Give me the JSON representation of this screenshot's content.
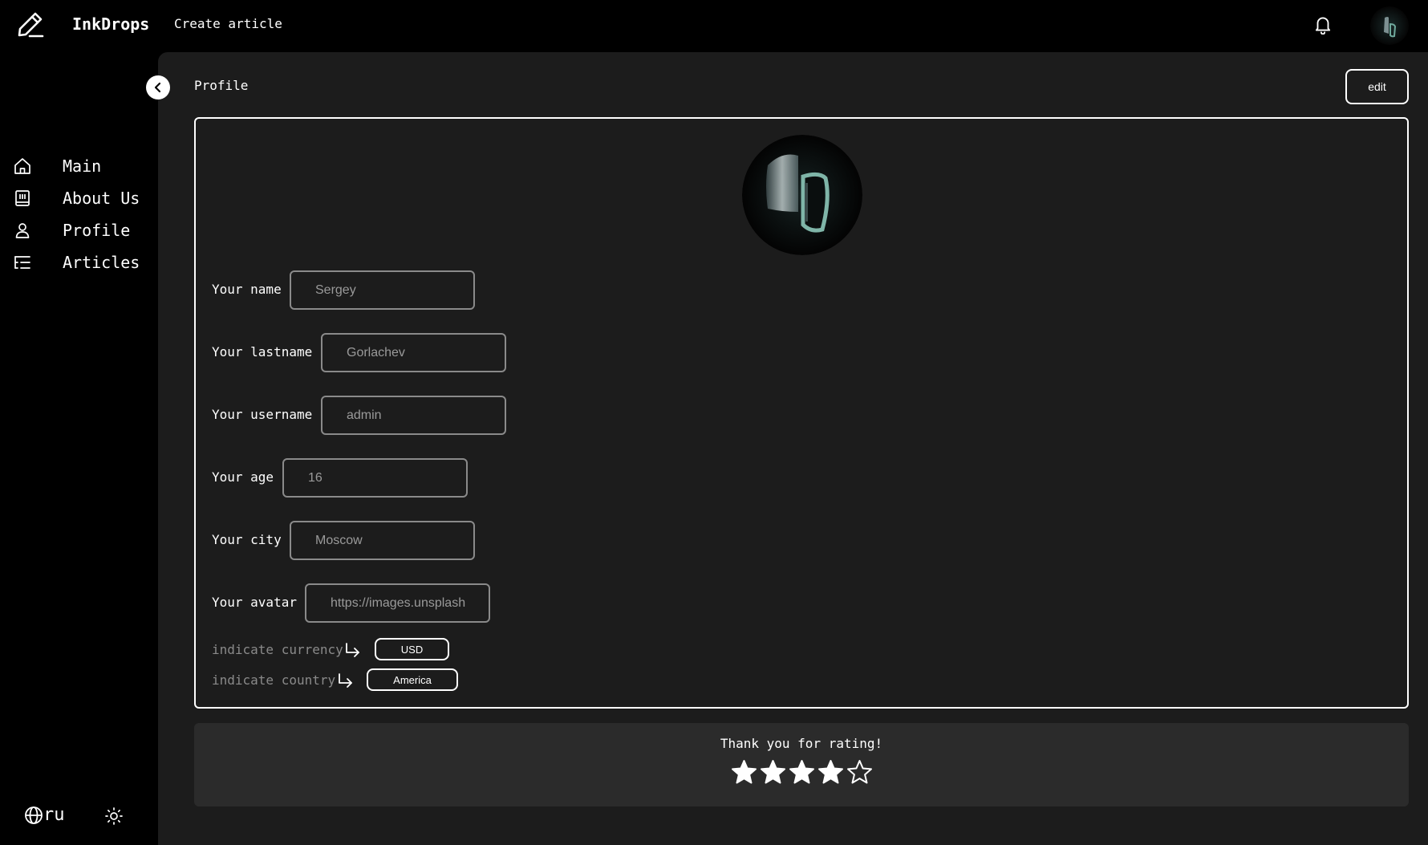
{
  "header": {
    "brand": "InkDrops",
    "create_link": "Create article"
  },
  "sidebar": {
    "items": [
      {
        "label": "Main",
        "icon": "home-icon"
      },
      {
        "label": "About Us",
        "icon": "about-icon"
      },
      {
        "label": "Profile",
        "icon": "user-icon"
      },
      {
        "label": "Articles",
        "icon": "list-icon"
      }
    ],
    "language": "ru"
  },
  "page": {
    "title": "Profile",
    "edit_label": "edit"
  },
  "profile": {
    "fields": [
      {
        "label": "Your name",
        "value": "Sergey"
      },
      {
        "label": "Your lastname",
        "value": "Gorlachev"
      },
      {
        "label": "Your username",
        "value": "admin"
      },
      {
        "label": "Your age",
        "value": "16"
      },
      {
        "label": "Your city",
        "value": "Moscow"
      },
      {
        "label": "Your avatar",
        "value": "https://images.unsplash"
      }
    ],
    "currency_label": "indicate currency",
    "currency_value": "USD",
    "country_label": "indicate country",
    "country_value": "America"
  },
  "rating": {
    "text": "Thank you for rating!",
    "stars_filled": 4,
    "stars_total": 5
  }
}
